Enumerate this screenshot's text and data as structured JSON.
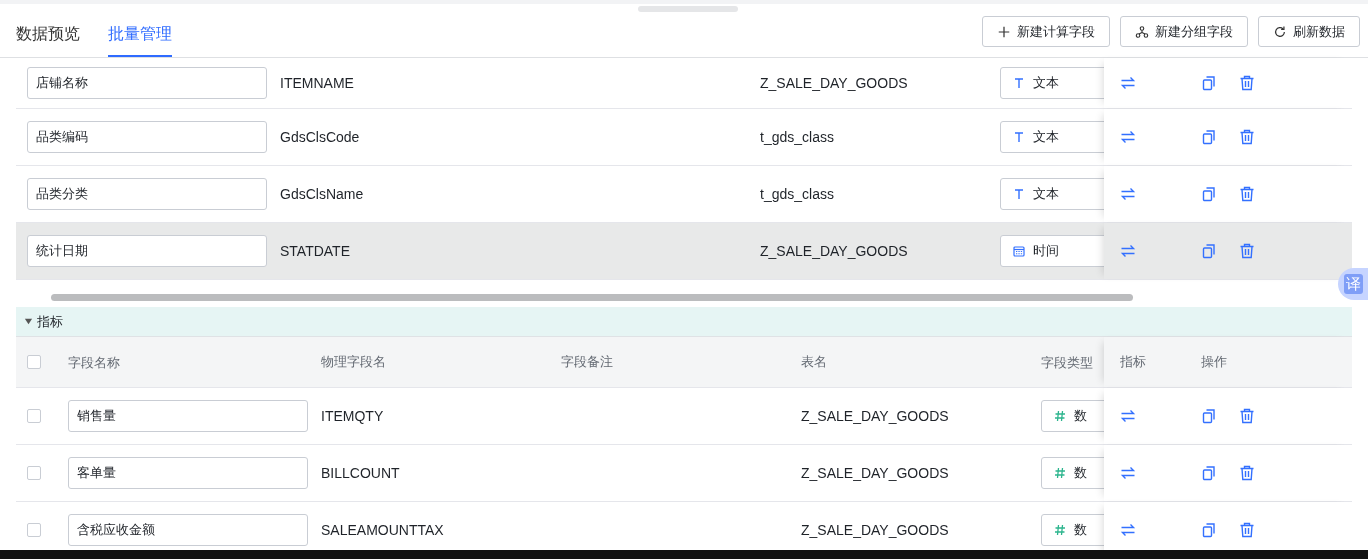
{
  "tabs": [
    {
      "label": "数据预览",
      "selected": false
    },
    {
      "label": "批量管理",
      "selected": true
    }
  ],
  "toolbar_buttons": [
    {
      "kind": "plus",
      "label": "新建计算字段"
    },
    {
      "kind": "group",
      "label": "新建分组字段"
    },
    {
      "kind": "refresh",
      "label": "刷新数据"
    }
  ],
  "dimension_rows": [
    {
      "name": "店铺名称",
      "physical_name": "ITEMNAME",
      "table": "Z_SALE_DAY_GOODS",
      "type": {
        "kind": "text",
        "label": "文本"
      },
      "hovered": false
    },
    {
      "name": "品类编码",
      "physical_name": "GdsClsCode",
      "table": "t_gds_class",
      "type": {
        "kind": "text",
        "label": "文本"
      },
      "hovered": false
    },
    {
      "name": "品类分类",
      "physical_name": "GdsClsName",
      "table": "t_gds_class",
      "type": {
        "kind": "text",
        "label": "文本"
      },
      "hovered": false
    },
    {
      "name": "统计日期",
      "physical_name": "STATDATE",
      "table": "Z_SALE_DAY_GOODS",
      "type": {
        "kind": "date",
        "label": "时间"
      },
      "hovered": true
    }
  ],
  "measures": {
    "title": "指标",
    "expanded": true,
    "select_all_checked": false,
    "columns": [
      "字段名称",
      "物理字段名",
      "字段备注",
      "表名",
      "字段类型",
      "指标",
      "操作"
    ],
    "rows": [
      {
        "checked": false,
        "name": "销售量",
        "physical_name": "ITEMQTY",
        "table": "Z_SALE_DAY_GOODS",
        "type": {
          "kind": "number",
          "label": "数"
        }
      },
      {
        "checked": false,
        "name": "客单量",
        "physical_name": "BILLCOUNT",
        "table": "Z_SALE_DAY_GOODS",
        "type": {
          "kind": "number",
          "label": "数"
        }
      },
      {
        "checked": false,
        "name": "含税应收金额",
        "physical_name": "SALEAMOUNTTAX",
        "table": "Z_SALE_DAY_GOODS",
        "type": {
          "kind": "number",
          "label": "数"
        }
      }
    ]
  },
  "translate_button": "译"
}
